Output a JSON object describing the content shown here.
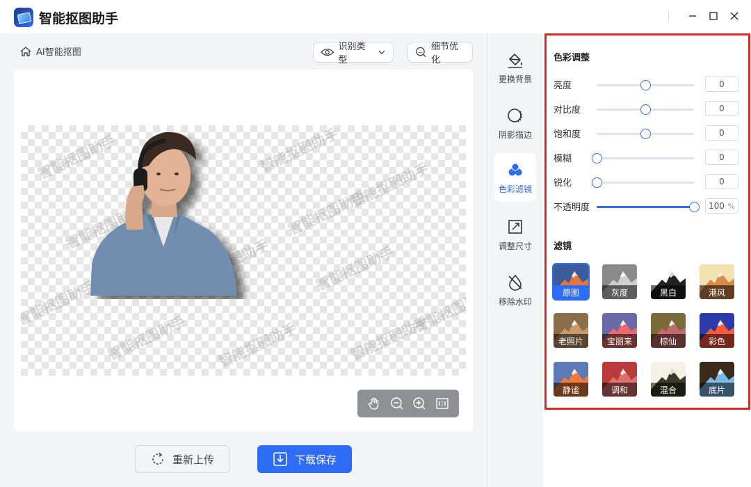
{
  "app": {
    "title": "智能抠图助手"
  },
  "breadcrumb": {
    "label": "AI智能抠图"
  },
  "toolbar": {
    "recognize_label": "识别类型",
    "detail_label": "细节优化"
  },
  "canvas": {
    "watermark": "智能抠图助手"
  },
  "actions": {
    "reupload_label": "重新上传",
    "download_label": "下载保存"
  },
  "tools": [
    {
      "label": "更换背景",
      "icon": "paint-bucket-icon"
    },
    {
      "label": "阴影描边",
      "icon": "shadow-outline-icon"
    },
    {
      "label": "色彩滤镜",
      "icon": "color-filter-icon",
      "active": true
    },
    {
      "label": "调整尺寸",
      "icon": "resize-icon"
    },
    {
      "label": "移除水印",
      "icon": "remove-watermark-icon"
    }
  ],
  "color_adjust": {
    "title": "色彩调整",
    "rows": [
      {
        "label": "亮度",
        "value": "0",
        "level": 0.5
      },
      {
        "label": "对比度",
        "value": "0",
        "level": 0.5
      },
      {
        "label": "饱和度",
        "value": "0",
        "level": 0.5
      },
      {
        "label": "模糊",
        "value": "0",
        "level": 0
      },
      {
        "label": "锐化",
        "value": "0",
        "level": 0
      },
      {
        "label": "不透明度",
        "value": "100",
        "unit": "%",
        "level": 1
      }
    ]
  },
  "filters": {
    "title": "滤镜",
    "items": [
      {
        "label": "原图",
        "sky": "#3b5b9a",
        "peak": "#e8743b",
        "selected": true
      },
      {
        "label": "灰度",
        "sky": "#8a8a8a",
        "peak": "#cfcfcf"
      },
      {
        "label": "黑白",
        "sky": "#ffffff",
        "peak": "#222222"
      },
      {
        "label": "港风",
        "sky": "#f3e2b0",
        "peak": "#d88a4a"
      },
      {
        "label": "老照片",
        "sky": "#8a6e4a",
        "peak": "#c89a6a"
      },
      {
        "label": "宝丽来",
        "sky": "#6a6aa8",
        "peak": "#ee6a6a"
      },
      {
        "label": "棕仙",
        "sky": "#7a6a3a",
        "peak": "#c46a6a"
      },
      {
        "label": "彩色",
        "sky": "#2a3aa8",
        "peak": "#ff5a3a"
      },
      {
        "label": "静谧",
        "sky": "#5a7ab8",
        "peak": "#f07a3a"
      },
      {
        "label": "调和",
        "sky": "#b83a3a",
        "peak": "#e07070"
      },
      {
        "label": "混合",
        "sky": "#f6f1e2",
        "peak": "#3a3a2a"
      },
      {
        "label": "底片",
        "sky": "#3a2a1a",
        "peak": "#7ab8e8"
      }
    ]
  },
  "colors": {
    "accent": "#2f6cf5",
    "highlight_border": "#d42a2a"
  }
}
